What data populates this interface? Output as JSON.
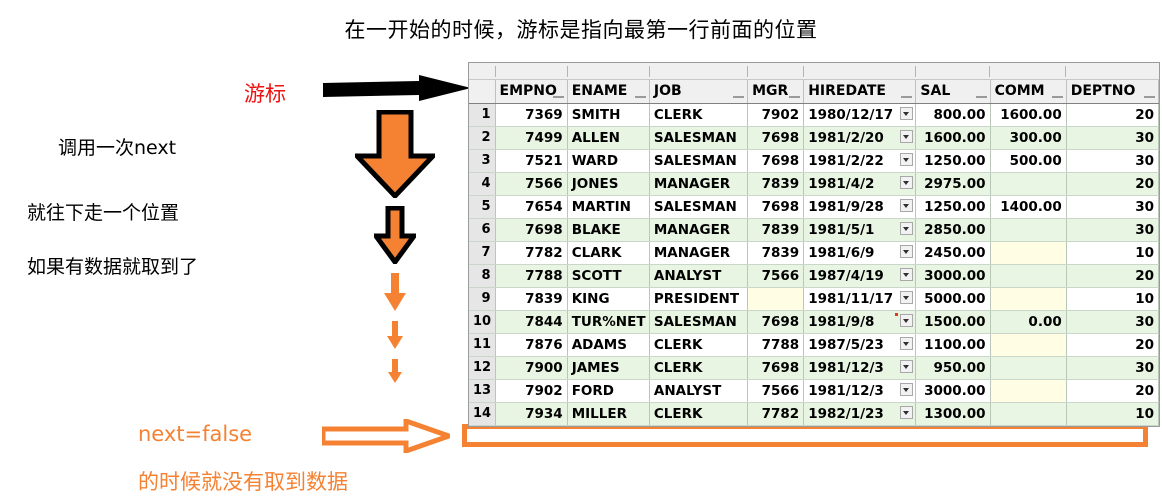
{
  "title": "在一开始的时候，游标是指向最第一行前面的位置",
  "annotations": {
    "cursor_label": "游标",
    "note1": "调用一次next",
    "note2": "就往下走一个位置",
    "note3": "如果有数据就取到了",
    "next_label_1": "next",
    "next_label_2": "next",
    "false_label": "next=false",
    "false_note": "的时候就没有取到数据"
  },
  "colors": {
    "orange": "#f58233",
    "red": "#ee1111",
    "black": "#000000",
    "row_even_bg": "#e8f5e2",
    "row_odd_bg": "#ffffff",
    "null_cell_bg": "#fffde3",
    "header_bg": "#f0f0f0",
    "rownum_bg": "#e6e6e6"
  },
  "grid": {
    "columns": [
      "EMPNO",
      "ENAME",
      "JOB",
      "MGR",
      "HIREDATE",
      "SAL",
      "COMM",
      "DEPTNO"
    ],
    "rows": [
      {
        "n": "1",
        "EMPNO": "7369",
        "ENAME": "SMITH",
        "JOB": "CLERK",
        "MGR": "7902",
        "HIREDATE": "1980/12/17",
        "SAL": "800.00",
        "COMM": "1600.00",
        "DEPTNO": "20"
      },
      {
        "n": "2",
        "EMPNO": "7499",
        "ENAME": "ALLEN",
        "JOB": "SALESMAN",
        "MGR": "7698",
        "HIREDATE": "1981/2/20",
        "SAL": "1600.00",
        "COMM": "300.00",
        "DEPTNO": "30"
      },
      {
        "n": "3",
        "EMPNO": "7521",
        "ENAME": "WARD",
        "JOB": "SALESMAN",
        "MGR": "7698",
        "HIREDATE": "1981/2/22",
        "SAL": "1250.00",
        "COMM": "500.00",
        "DEPTNO": "30"
      },
      {
        "n": "4",
        "EMPNO": "7566",
        "ENAME": "JONES",
        "JOB": "MANAGER",
        "MGR": "7839",
        "HIREDATE": "1981/4/2",
        "SAL": "2975.00",
        "COMM": "",
        "DEPTNO": "20"
      },
      {
        "n": "5",
        "EMPNO": "7654",
        "ENAME": "MARTIN",
        "JOB": "SALESMAN",
        "MGR": "7698",
        "HIREDATE": "1981/9/28",
        "SAL": "1250.00",
        "COMM": "1400.00",
        "DEPTNO": "30"
      },
      {
        "n": "6",
        "EMPNO": "7698",
        "ENAME": "BLAKE",
        "JOB": "MANAGER",
        "MGR": "7839",
        "HIREDATE": "1981/5/1",
        "SAL": "2850.00",
        "COMM": "",
        "DEPTNO": "30"
      },
      {
        "n": "7",
        "EMPNO": "7782",
        "ENAME": "CLARK",
        "JOB": "MANAGER",
        "MGR": "7839",
        "HIREDATE": "1981/6/9",
        "SAL": "2450.00",
        "COMM": "",
        "DEPTNO": "10"
      },
      {
        "n": "8",
        "EMPNO": "7788",
        "ENAME": "SCOTT",
        "JOB": "ANALYST",
        "MGR": "7566",
        "HIREDATE": "1987/4/19",
        "SAL": "3000.00",
        "COMM": "",
        "DEPTNO": "20"
      },
      {
        "n": "9",
        "EMPNO": "7839",
        "ENAME": "KING",
        "JOB": "PRESIDENT",
        "MGR": "",
        "HIREDATE": "1981/11/17",
        "SAL": "5000.00",
        "COMM": "",
        "DEPTNO": "10"
      },
      {
        "n": "10",
        "EMPNO": "7844",
        "ENAME": "TUR%NET",
        "JOB": "SALESMAN",
        "MGR": "7698",
        "HIREDATE": "1981/9/8",
        "SAL": "1500.00",
        "COMM": "0.00",
        "DEPTNO": "30"
      },
      {
        "n": "11",
        "EMPNO": "7876",
        "ENAME": "ADAMS",
        "JOB": "CLERK",
        "MGR": "7788",
        "HIREDATE": "1987/5/23",
        "SAL": "1100.00",
        "COMM": "",
        "DEPTNO": "20"
      },
      {
        "n": "12",
        "EMPNO": "7900",
        "ENAME": "JAMES",
        "JOB": "CLERK",
        "MGR": "7698",
        "HIREDATE": "1981/12/3",
        "SAL": "950.00",
        "COMM": "",
        "DEPTNO": "30"
      },
      {
        "n": "13",
        "EMPNO": "7902",
        "ENAME": "FORD",
        "JOB": "ANALYST",
        "MGR": "7566",
        "HIREDATE": "1981/12/3",
        "SAL": "3000.00",
        "COMM": "",
        "DEPTNO": "20"
      },
      {
        "n": "14",
        "EMPNO": "7934",
        "ENAME": "MILLER",
        "JOB": "CLERK",
        "MGR": "7782",
        "HIREDATE": "1982/1/23",
        "SAL": "1300.00",
        "COMM": "",
        "DEPTNO": "10"
      }
    ]
  }
}
